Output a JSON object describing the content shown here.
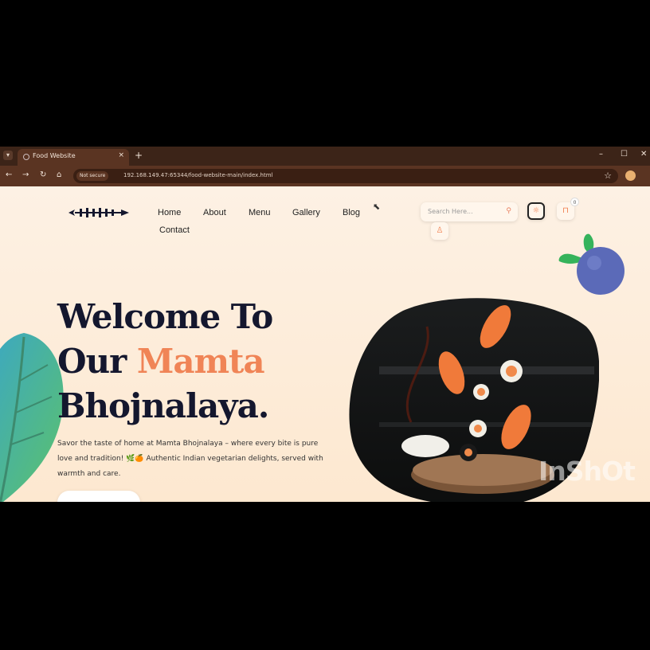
{
  "browser": {
    "tab_title": "Food Website",
    "tab_close": "×",
    "new_tab": "+",
    "window_controls": [
      "–",
      "☐",
      "✕"
    ],
    "nav_buttons": [
      "←",
      "→",
      "↻",
      "⌂"
    ],
    "security_label": "Not secure",
    "url": "192.168.149.47:65344/food-website-main/index.html",
    "star_icon": "☆"
  },
  "nav": {
    "links": [
      "Home",
      "About",
      "Menu",
      "Gallery",
      "Blog",
      "Contact"
    ]
  },
  "search": {
    "placeholder": "Search Here...",
    "icon": "⚲"
  },
  "icons": {
    "theme": "☼",
    "cart": "⊓",
    "cart_count": "0",
    "user": "♙"
  },
  "hero": {
    "title_line1": "Welcome To",
    "title_line2_pre": "Our ",
    "title_line2_accent": "Mamta",
    "title_line3": "Bhojnalaya.",
    "description": "Savor the taste of home at Mamta Bhojnalaya – where every bite is pure love and tradition! 🌿🍊 Authentic Indian vegetarian delights, served with warmth and care."
  },
  "watermark": "InShOt",
  "colors": {
    "accent": "#f08456",
    "title": "#14172e",
    "page_bg": "#fdf1e2",
    "browser_chrome": "#3c2418"
  }
}
